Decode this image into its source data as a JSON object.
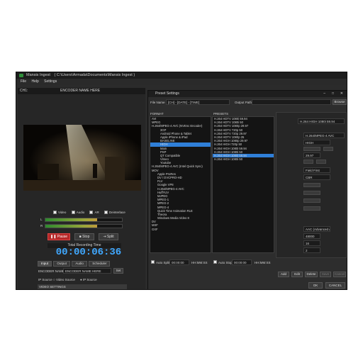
{
  "app": {
    "title": "Mansis Ingest",
    "path": "( C:\\Users\\Armada\\Documents\\Mansis Ingest )"
  },
  "menu": [
    "File",
    "Help",
    "Settings"
  ],
  "channel": {
    "label": "CH1:",
    "name": "ENCODER NAME HERE"
  },
  "checkboxes": [
    "Video",
    "Audio",
    "AR",
    "Deinterlace"
  ],
  "meters": [
    {
      "label": "L",
      "level": 0.68
    },
    {
      "label": "R",
      "level": 0.68
    }
  ],
  "controls": {
    "pause": "Pause",
    "stop": "Stop",
    "split": "Split"
  },
  "recording": {
    "label": "Total Recording Time",
    "time": "00:00:06:36"
  },
  "tabs": [
    "Input",
    "Output",
    "Audio",
    "Scheduler"
  ],
  "encoder": {
    "label": "ENCODER NAME:",
    "value": "ENCODER NAME HERE",
    "set": "Set"
  },
  "source": {
    "label": "IP Source",
    "video": "Video Source",
    "ip": "IP Source"
  },
  "video_settings": "VIDEO SETTINGS",
  "dialog": {
    "title": "Preset Settings",
    "file_name_label": "File Name",
    "file_name_value": "[CH] - [DATE] - [TIME]",
    "output_path_label": "Output Path",
    "browse": "Browse",
    "format_header": "FORMAT",
    "presets_header": "PRESETS",
    "formats": [
      "AVI",
      "MPEG",
      "H.264/MPEG-4 AVC (NVEnc Encoder)",
      "3GP",
      "Android Phone & Tablet",
      "Apple iPhone & iPad",
      "BASELINE",
      "HIGH",
      "Main",
      "PSP",
      "QT Compatible",
      "Vimeo",
      "Youtube",
      "H.264/MPEG-4 AVC (Intel Quick Sync)",
      "MOV",
      "Apple ProRes",
      "DV / DVCPRO-HD",
      "FLV",
      "Google VP8",
      "H.264/MPEG-4 AVC",
      "HuffYUV",
      "MJPEG",
      "MPEG-1",
      "MPEG-2",
      "MPEG-4",
      "Quick Time Animation RLE",
      "Theora",
      "Windows Media Video 8",
      "DV",
      "MXF",
      "GXF"
    ],
    "selected_format": 7,
    "presets": [
      "H.264 HDTV 1080i 59.94",
      "H.264 HDTV 1080i 50",
      "H.264 HDTV 1080p 29.97",
      "H.264 HDTV 720p 50",
      "H.264 HDTV 720p 29.97",
      "H.264 HDTV 1080p 25",
      "H.264 HIGH 1080p 29.97",
      "H.264 HIGH 720p 50",
      "H.264 HIGH 1080i 59.94",
      "H.264 HIGH 1080i 50",
      "H.264 HIGH 1080i 59.94",
      "H.264 HIGH 1080i 50"
    ],
    "selected_preset": 10,
    "auto_split": "Auto Split",
    "auto_split_time": "00:00:00",
    "auto_stop": "Auto Stop",
    "auto_stop_time": "00:00:00",
    "time_fmt": "HH:MM:SS",
    "right": {
      "preset_name": "H.264 HIGH 1080i 59.94",
      "codec": "H.264/MPEG-4 AVC",
      "profile": "HIGH",
      "fps": "29.97",
      "field": "Field First",
      "rate": "CBR",
      "audio": "AAC (Advanced Au",
      "samplerate": "48000",
      "bits": "16",
      "channels": "2"
    },
    "buttons": {
      "add": "Add",
      "edit": "Edit",
      "delete": "Delete",
      "save": "Save",
      "cancel": "Cancel"
    },
    "ok": "OK",
    "cancel": "CANCEL"
  }
}
